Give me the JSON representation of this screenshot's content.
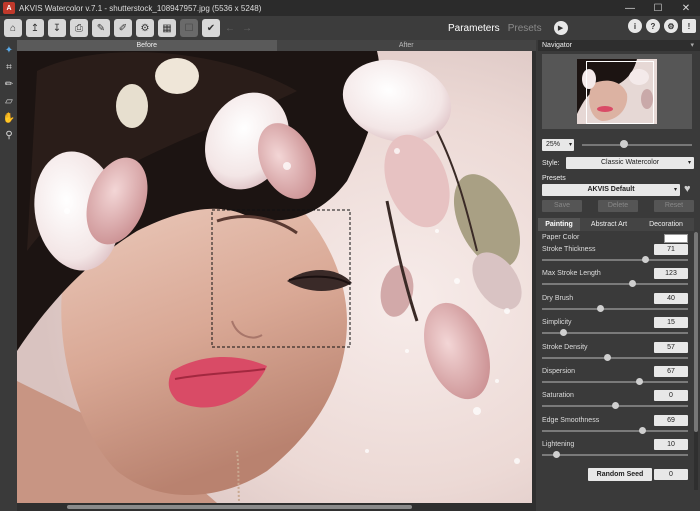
{
  "window": {
    "title": "AKVIS Watercolor v.7.1 - shutterstock_108947957.jpg (5536 x 5248)",
    "logo_letter": "A",
    "minimize": "—",
    "maximize": "☐",
    "close": "✕"
  },
  "toolbar": {
    "modes": {
      "parameters": "Parameters",
      "presets": "Presets"
    },
    "run_icon": "▶",
    "right_icons": [
      "info-icon",
      "help-icon",
      "settings-icon",
      "notification-icon"
    ],
    "right_glyphs": [
      "i",
      "?",
      "⚙",
      "!"
    ]
  },
  "canvas": {
    "before_label": "Before",
    "after_label": "After"
  },
  "navigator": {
    "title": "Navigator",
    "zoom_value": "25%"
  },
  "style": {
    "label": "Style:",
    "value": "Classic Watercolor"
  },
  "presets": {
    "label": "Presets",
    "value": "AKVIS Default",
    "save": "Save",
    "delete": "Delete",
    "reset": "Reset"
  },
  "param_tabs": [
    "Painting",
    "Abstract Art",
    "Decoration"
  ],
  "paper_color_label": "Paper Color",
  "params": [
    {
      "label": "Stroke Thickness",
      "value": "71",
      "fraction": 0.71
    },
    {
      "label": "Max Stroke Length",
      "value": "123",
      "fraction": 0.62
    },
    {
      "label": "Dry Brush",
      "value": "40",
      "fraction": 0.4
    },
    {
      "label": "Simplicity",
      "value": "15",
      "fraction": 0.15
    },
    {
      "label": "Stroke Density",
      "value": "57",
      "fraction": 0.45
    },
    {
      "label": "Dispersion",
      "value": "67",
      "fraction": 0.67
    },
    {
      "label": "Saturation",
      "value": "0",
      "fraction": 0.5
    },
    {
      "label": "Edge Smoothness",
      "value": "69",
      "fraction": 0.69
    },
    {
      "label": "Lightening",
      "value": "10",
      "fraction": 0.1
    }
  ],
  "random_seed": {
    "label": "Random Seed",
    "value": "0"
  },
  "colors": {
    "accent_tool": "#5aa9e6",
    "background": "#3a3a3a"
  }
}
